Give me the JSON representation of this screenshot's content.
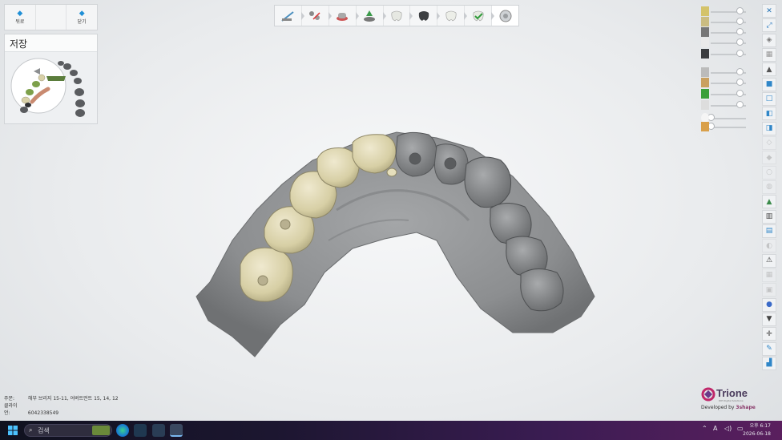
{
  "nav": {
    "back_label": "뒤로",
    "close_label": "닫기"
  },
  "panel": {
    "title": "저장"
  },
  "toolbar": {
    "steps": [
      "prep-tool-icon",
      "scissors-icon",
      "margin-icon",
      "insertion-icon",
      "tooth-anatomy-icon",
      "dark-tooth-icon",
      "connector-icon",
      "green-tooth-icon",
      "finish-disc-icon"
    ]
  },
  "order": {
    "order_label": "주문:",
    "order_value": "해부 브리지 15-11, 어버트먼트 15, 14, 12",
    "client_label": "클라이언:",
    "client_value": "6042338549"
  },
  "logo": {
    "name": "Trione",
    "sub": "DIE Digital Solutions",
    "dev_prefix": "Developed by",
    "dev_brand": "3shape"
  },
  "taskbar": {
    "search_placeholder": "검색",
    "clock_time": "오후 6:17",
    "clock_date": "2026-06-18",
    "ime": "A"
  },
  "colors": {
    "crown": "#d9d1a8",
    "gum": "#8f9092",
    "accent": "#1f8fd6"
  }
}
